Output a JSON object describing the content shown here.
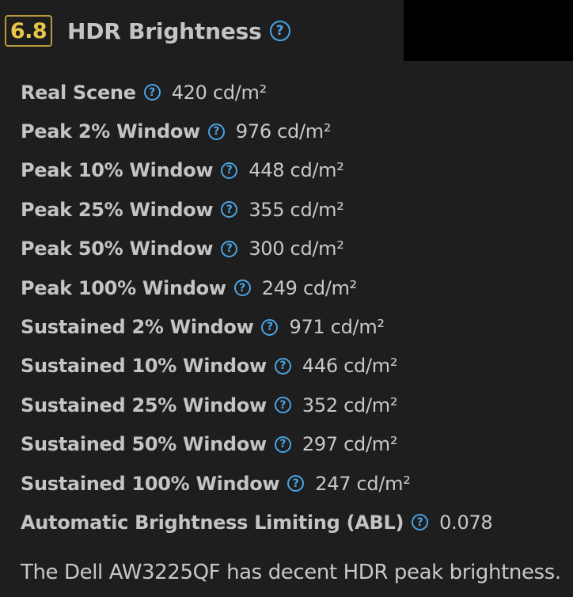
{
  "header": {
    "score": "6.8",
    "title": "HDR Brightness",
    "help_icon": "question-circle-icon"
  },
  "rows": [
    {
      "label": "Real Scene",
      "value": "420 cd/m²"
    },
    {
      "label": "Peak 2% Window",
      "value": "976 cd/m²"
    },
    {
      "label": "Peak 10% Window",
      "value": "448 cd/m²"
    },
    {
      "label": "Peak 25% Window",
      "value": "355 cd/m²"
    },
    {
      "label": "Peak 50% Window",
      "value": "300 cd/m²"
    },
    {
      "label": "Peak 100% Window",
      "value": "249 cd/m²"
    },
    {
      "label": "Sustained 2% Window",
      "value": "971 cd/m²"
    },
    {
      "label": "Sustained 10% Window",
      "value": "446 cd/m²"
    },
    {
      "label": "Sustained 25% Window",
      "value": "352 cd/m²"
    },
    {
      "label": "Sustained 50% Window",
      "value": "297 cd/m²"
    },
    {
      "label": "Sustained 100% Window",
      "value": "247 cd/m²"
    },
    {
      "label": "Automatic Brightness Limiting (ABL)",
      "value": "0.078"
    }
  ],
  "summary": "The Dell AW3225QF has decent HDR peak brightness.",
  "colors": {
    "background": "#1e1e1e",
    "score_border": "#b89a3c",
    "score_text": "#e8c64a",
    "help_icon": "#4ba3e3",
    "text": "#c8c8c8"
  }
}
